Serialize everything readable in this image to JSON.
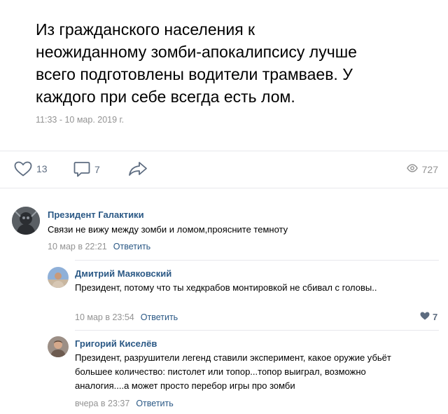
{
  "post": {
    "text": "Из гражданского населения к\nнеожиданному зомби-апокалипсису лучше\nвсего подготовлены водители трамваев. У\nкаждого при себе всегда есть лом.",
    "date": "11:33 - 10 мар. 2019 г."
  },
  "actions": {
    "likes": "13",
    "comments": "7",
    "views": "727"
  },
  "comments": [
    {
      "author": "Президент Галактики",
      "text": "Связи не вижу между зомби и ломом,проясните темноту",
      "time": "10 мар в 22:21",
      "reply": "Ответить"
    },
    {
      "author": "Дмитрий Маяковский",
      "text": "Президент, потому что ты хедкрабов монтировкой не сбивал с головы..",
      "time": "10 мар в 23:54",
      "reply": "Ответить",
      "likes": "7"
    },
    {
      "author": "Григорий Киселёв",
      "text": "Президент, разрушители легенд ставили эксперимент, какое оружие убьёт большее количество: пистолет или топор...топор выиграл, возможно аналогия....а может просто перебор игры про зомби",
      "time": "вчера в 23:37",
      "reply": "Ответить"
    }
  ],
  "colors": {
    "link": "#2a5885",
    "meta": "#939393",
    "icon": "#5d6c80",
    "divider": "#e7e8ec"
  }
}
